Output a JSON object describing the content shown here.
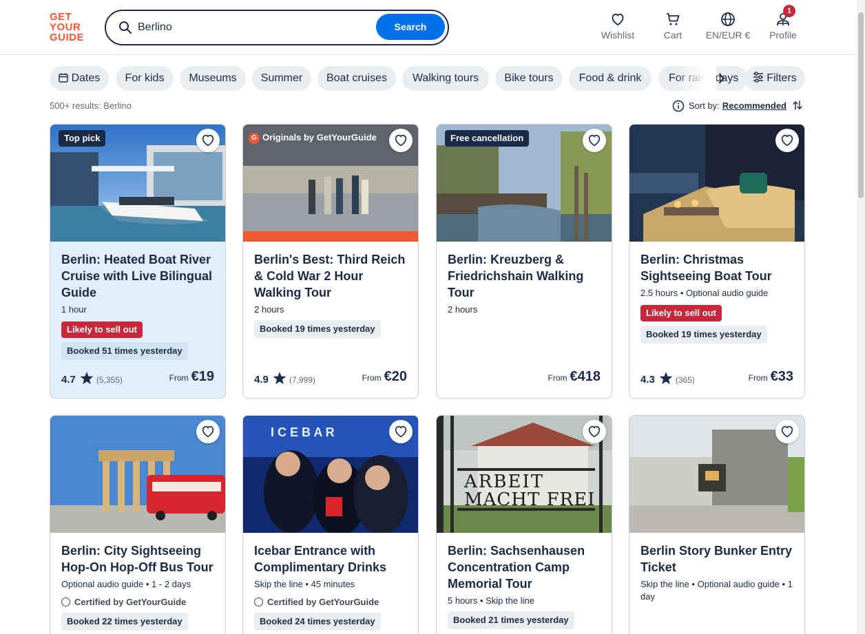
{
  "header": {
    "logo_lines": [
      "GET",
      "YOUR",
      "GUIDE"
    ],
    "search_value": "Berlino",
    "search_button": "Search",
    "wishlist": "Wishlist",
    "cart": "Cart",
    "language": "EN/EUR €",
    "profile": "Profile",
    "profile_badge": "1"
  },
  "chips": {
    "dates": "Dates",
    "for_kids": "For kids",
    "museums": "Museums",
    "summer": "Summer",
    "boat_cruises": "Boat cruises",
    "walking_tours": "Walking tours",
    "bike_tours": "Bike tours",
    "food_drink": "Food & drink",
    "for_rainy": "For rainy days",
    "filters": "Filters"
  },
  "results": {
    "count": "500+ results: Berlino",
    "sort_label": "Sort by:",
    "sort_value": "Recommended"
  },
  "cards": [
    {
      "tag": "Top pick",
      "title": "Berlin: Heated Boat River Cruise with Live Bilingual Guide",
      "meta": "1 hour",
      "sell": "Likely to sell out",
      "booked": "Booked 51 times yesterday",
      "rating": "4.7",
      "reviews": "(5,355)",
      "from": "From",
      "price": "€19"
    },
    {
      "tag": "Originals by GetYourGuide",
      "title": "Berlin's Best: Third Reich & Cold War 2 Hour Walking Tour",
      "meta": "2 hours",
      "booked": "Booked 19 times yesterday",
      "rating": "4.9",
      "reviews": "(7,999)",
      "from": "From",
      "price": "€20"
    },
    {
      "tag": "Free cancellation",
      "title": "Berlin: Kreuzberg & Friedrichshain Walking Tour",
      "meta": "2 hours",
      "from": "From",
      "price": "€418"
    },
    {
      "title": "Berlin: Christmas Sightseeing Boat Tour",
      "meta": "2.5 hours • Optional audio guide",
      "sell": "Likely to sell out",
      "booked": "Booked 19 times yesterday",
      "rating": "4.3",
      "reviews": "(365)",
      "from": "From",
      "price": "€33"
    },
    {
      "title": "Berlin: City Sightseeing Hop-On Hop-Off Bus Tour",
      "meta": "Optional audio guide • 1 - 2 days",
      "cert": "Certified by GetYourGuide",
      "booked": "Booked 22 times yesterday"
    },
    {
      "title": "Icebar Entrance with Complimentary Drinks",
      "meta": "Skip the line • 45 minutes",
      "cert": "Certified by GetYourGuide",
      "booked": "Booked 24 times yesterday"
    },
    {
      "title": "Berlin: Sachsenhausen Concentration Camp Memorial Tour",
      "meta": "5 hours • Skip the line",
      "booked": "Booked 21 times yesterday"
    },
    {
      "title": "Berlin Story Bunker Entry Ticket",
      "meta": "Skip the line • Optional audio guide • 1 day"
    }
  ],
  "icons": {
    "search": "search-icon",
    "heart": "heart-icon",
    "cart": "cart-icon",
    "globe": "globe-icon",
    "profile": "profile-icon",
    "calendar": "calendar-icon",
    "filters": "sliders-icon",
    "info": "info-icon",
    "sort": "sort-arrows-icon",
    "star": "star-icon"
  },
  "colors": {
    "brand": "#ff5533",
    "primary": "#0071eb",
    "text": "#1a2b49",
    "alert": "#c7283b"
  }
}
